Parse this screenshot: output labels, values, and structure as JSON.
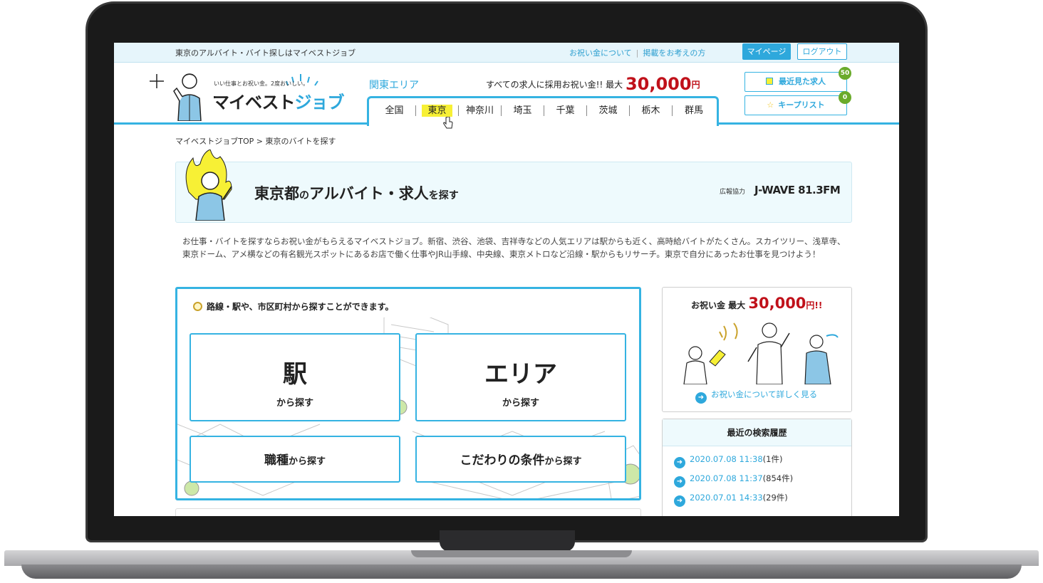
{
  "topbar": {
    "tagline": "東京のアルバイト・バイト探しはマイベストジョブ",
    "link_bonus": "お祝い金について",
    "separator": "|",
    "link_listing": "掲載をお考えの方",
    "mypage": "マイページ",
    "logout": "ログアウト"
  },
  "logo": {
    "sub": "いい仕事とお祝い金。2度おいしい。",
    "main_a": "マイベスト",
    "main_b": "ジョブ"
  },
  "header": {
    "region": "関東エリア",
    "promo_text": "すべての求人に採用お祝い金!! 最大",
    "promo_amount": "30,000",
    "promo_unit": "円",
    "prefs": [
      "全国",
      "東京",
      "神奈川",
      "埼玉",
      "千葉",
      "茨城",
      "栃木",
      "群馬"
    ],
    "active_pref": "東京",
    "recent_jobs": "最近見た求人",
    "recent_count": "50",
    "keep_list": "キープリスト",
    "keep_count": "0"
  },
  "breadcrumb": {
    "home": "マイベストジョブTOP",
    "arrow": ">",
    "current": "東京のバイトを探す"
  },
  "title": {
    "part1": "東京都",
    "part2": "の",
    "part3": "アルバイト・求人",
    "part4": "を探す",
    "pr_label": "広報協力",
    "sponsor": "J-WAVE 81.3FM"
  },
  "intro": "お仕事・バイトを探すならお祝い金がもらえるマイベストジョブ。新宿、渋谷、池袋、吉祥寺などの人気エリアは駅からも近く、高時給バイトがたくさん。スカイツリー、浅草寺、東京ドーム、アメ横などの有名観光スポットにあるお店で働く仕事やJR山手線、中央線、東京メトロなど沿線・駅からもリサーチ。東京で自分にあったお仕事を見つけよう！",
  "search": {
    "title": "路線・駅や、市区町村から探すことができます。",
    "station": "駅",
    "station_sub": "から探す",
    "area": "エリア",
    "area_sub": "から探す",
    "job_a": "職種",
    "job_b": "から探す",
    "cond_a": "こだわりの条件",
    "cond_b": "から探す"
  },
  "bonus_card": {
    "label": "お祝い金 最大",
    "amount": "30,000",
    "unit": "円!!",
    "more": "お祝い金について詳しく見る"
  },
  "history": {
    "title": "最近の検索履歴",
    "items": [
      {
        "date": "2020.07.08 11:38",
        "count": "(1件)"
      },
      {
        "date": "2020.07.08 11:37",
        "count": "(854件)"
      },
      {
        "date": "2020.07.01 14:33",
        "count": "(29件)"
      }
    ]
  },
  "colors": {
    "accent": "#2ea8dc",
    "price": "#c0111a",
    "highlight": "#f7f035",
    "badge": "#6aab2b"
  }
}
